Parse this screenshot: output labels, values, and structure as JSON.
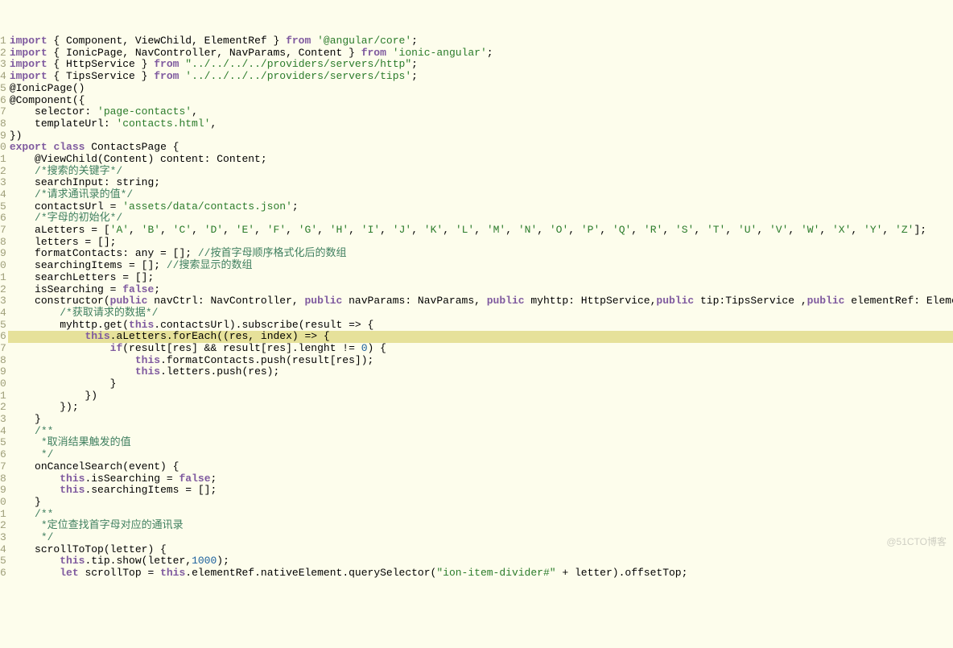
{
  "start_line": 1,
  "highlighted": 16,
  "watermark": "@51CTO博客",
  "lines": [
    {
      "segs": [
        {
          "t": "import",
          "c": "kw"
        },
        {
          "t": " { Component, ViewChild, ElementRef } "
        },
        {
          "t": "from",
          "c": "kw"
        },
        {
          "t": " "
        },
        {
          "t": "'@angular/core'",
          "c": "str"
        },
        {
          "t": ";"
        }
      ]
    },
    {
      "segs": [
        {
          "t": "import",
          "c": "kw"
        },
        {
          "t": " { IonicPage, NavController, NavParams, Content } "
        },
        {
          "t": "from",
          "c": "kw"
        },
        {
          "t": " "
        },
        {
          "t": "'ionic-angular'",
          "c": "str"
        },
        {
          "t": ";"
        }
      ]
    },
    {
      "segs": [
        {
          "t": "import",
          "c": "kw"
        },
        {
          "t": " { HttpService } "
        },
        {
          "t": "from",
          "c": "kw"
        },
        {
          "t": " "
        },
        {
          "t": "\"../../../../providers/servers/http\"",
          "c": "str"
        },
        {
          "t": ";"
        }
      ]
    },
    {
      "segs": [
        {
          "t": "import",
          "c": "kw"
        },
        {
          "t": " { TipsService } "
        },
        {
          "t": "from",
          "c": "kw"
        },
        {
          "t": " "
        },
        {
          "t": "'../../../../providers/servers/tips'",
          "c": "str"
        },
        {
          "t": ";"
        }
      ]
    },
    {
      "segs": [
        {
          "t": "@IonicPage()"
        }
      ],
      "fold": true
    },
    {
      "segs": [
        {
          "t": "@Component({"
        }
      ]
    },
    {
      "segs": [
        {
          "t": "    selector: "
        },
        {
          "t": "'page-contacts'",
          "c": "str"
        },
        {
          "t": ","
        }
      ]
    },
    {
      "segs": [
        {
          "t": "    templateUrl: "
        },
        {
          "t": "'contacts.html'",
          "c": "str"
        },
        {
          "t": ","
        }
      ]
    },
    {
      "segs": [
        {
          "t": "})"
        }
      ]
    },
    {
      "segs": [
        {
          "t": "export",
          "c": "kw"
        },
        {
          "t": " "
        },
        {
          "t": "class",
          "c": "kw"
        },
        {
          "t": " ContactsPage {"
        }
      ]
    },
    {
      "segs": [
        {
          "t": "    @ViewChild(Content) content: Content;"
        }
      ]
    },
    {
      "segs": [
        {
          "t": "    "
        },
        {
          "t": "/*搜索的关键字*/",
          "c": "cm"
        }
      ]
    },
    {
      "segs": [
        {
          "t": "    searchInput: string;"
        }
      ]
    },
    {
      "segs": [
        {
          "t": "    "
        },
        {
          "t": "/*请求通讯录的值*/",
          "c": "cm"
        }
      ]
    },
    {
      "segs": [
        {
          "t": "    contactsUrl = "
        },
        {
          "t": "'assets/data/contacts.json'",
          "c": "str"
        },
        {
          "t": ";"
        }
      ]
    },
    {
      "segs": [
        {
          "t": "    "
        },
        {
          "t": "/*字母的初始化*/",
          "c": "cm"
        }
      ]
    },
    {
      "segs": [
        {
          "t": "    aLetters = ["
        },
        {
          "t": "'A'",
          "c": "str"
        },
        {
          "t": ", "
        },
        {
          "t": "'B'",
          "c": "str"
        },
        {
          "t": ", "
        },
        {
          "t": "'C'",
          "c": "str"
        },
        {
          "t": ", "
        },
        {
          "t": "'D'",
          "c": "str"
        },
        {
          "t": ", "
        },
        {
          "t": "'E'",
          "c": "str"
        },
        {
          "t": ", "
        },
        {
          "t": "'F'",
          "c": "str"
        },
        {
          "t": ", "
        },
        {
          "t": "'G'",
          "c": "str"
        },
        {
          "t": ", "
        },
        {
          "t": "'H'",
          "c": "str"
        },
        {
          "t": ", "
        },
        {
          "t": "'I'",
          "c": "str"
        },
        {
          "t": ", "
        },
        {
          "t": "'J'",
          "c": "str"
        },
        {
          "t": ", "
        },
        {
          "t": "'K'",
          "c": "str"
        },
        {
          "t": ", "
        },
        {
          "t": "'L'",
          "c": "str"
        },
        {
          "t": ", "
        },
        {
          "t": "'M'",
          "c": "str"
        },
        {
          "t": ", "
        },
        {
          "t": "'N'",
          "c": "str"
        },
        {
          "t": ", "
        },
        {
          "t": "'O'",
          "c": "str"
        },
        {
          "t": ", "
        },
        {
          "t": "'P'",
          "c": "str"
        },
        {
          "t": ", "
        },
        {
          "t": "'Q'",
          "c": "str"
        },
        {
          "t": ", "
        },
        {
          "t": "'R'",
          "c": "str"
        },
        {
          "t": ", "
        },
        {
          "t": "'S'",
          "c": "str"
        },
        {
          "t": ", "
        },
        {
          "t": "'T'",
          "c": "str"
        },
        {
          "t": ", "
        },
        {
          "t": "'U'",
          "c": "str"
        },
        {
          "t": ", "
        },
        {
          "t": "'V'",
          "c": "str"
        },
        {
          "t": ", "
        },
        {
          "t": "'W'",
          "c": "str"
        },
        {
          "t": ", "
        },
        {
          "t": "'X'",
          "c": "str"
        },
        {
          "t": ", "
        },
        {
          "t": "'Y'",
          "c": "str"
        },
        {
          "t": ", "
        },
        {
          "t": "'Z'",
          "c": "str"
        },
        {
          "t": "];"
        }
      ]
    },
    {
      "segs": [
        {
          "t": "    letters = [];"
        }
      ]
    },
    {
      "segs": [
        {
          "t": "    formatContacts: any = []; "
        },
        {
          "t": "//按首字母顺序格式化后的数组",
          "c": "cm"
        }
      ]
    },
    {
      "segs": [
        {
          "t": "    searchingItems = []; "
        },
        {
          "t": "//搜索显示的数组",
          "c": "cm"
        }
      ]
    },
    {
      "segs": [
        {
          "t": "    searchLetters = [];"
        }
      ]
    },
    {
      "segs": [
        {
          "t": "    isSearching = "
        },
        {
          "t": "false",
          "c": "val"
        },
        {
          "t": ";"
        }
      ]
    },
    {
      "segs": [
        {
          "t": "    constructor("
        },
        {
          "t": "public",
          "c": "kw"
        },
        {
          "t": " navCtrl: NavController, "
        },
        {
          "t": "public",
          "c": "kw"
        },
        {
          "t": " navParams: NavParams, "
        },
        {
          "t": "public",
          "c": "kw"
        },
        {
          "t": " myhttp: HttpService,"
        },
        {
          "t": "public",
          "c": "kw"
        },
        {
          "t": " tip:TipsService ,"
        },
        {
          "t": "public",
          "c": "kw"
        },
        {
          "t": " elementRef: ElementRef) {"
        }
      ],
      "fold": true
    },
    {
      "segs": [
        {
          "t": "        "
        },
        {
          "t": "/*获取请求的数据*/",
          "c": "cm"
        }
      ]
    },
    {
      "segs": [
        {
          "t": "        myhttp.get("
        },
        {
          "t": "this",
          "c": "kw"
        },
        {
          "t": ".contactsUrl).subscribe(result => {"
        }
      ],
      "fold": true
    },
    {
      "segs": [
        {
          "t": "            "
        },
        {
          "t": "this",
          "c": "kw"
        },
        {
          "t": ".aLetters.forEach((res, index) => {"
        }
      ],
      "fold": true,
      "hl": true
    },
    {
      "segs": [
        {
          "t": "                "
        },
        {
          "t": "if",
          "c": "kw"
        },
        {
          "t": "(result[res] && result[res].lenght != "
        },
        {
          "t": "0",
          "c": "num"
        },
        {
          "t": ") {"
        }
      ],
      "fold": true
    },
    {
      "segs": [
        {
          "t": "                    "
        },
        {
          "t": "this",
          "c": "kw"
        },
        {
          "t": ".formatContacts.push(result[res]);"
        }
      ]
    },
    {
      "segs": [
        {
          "t": "                    "
        },
        {
          "t": "this",
          "c": "kw"
        },
        {
          "t": ".letters.push(res);"
        }
      ]
    },
    {
      "segs": [
        {
          "t": "                }"
        }
      ]
    },
    {
      "segs": [
        {
          "t": "            })"
        }
      ]
    },
    {
      "segs": [
        {
          "t": "        });"
        }
      ]
    },
    {
      "segs": [
        {
          "t": "    }"
        }
      ]
    },
    {
      "segs": [
        {
          "t": "    "
        },
        {
          "t": "/**",
          "c": "cm"
        }
      ]
    },
    {
      "segs": [
        {
          "t": "     *取消结果触发的值",
          "c": "cm"
        }
      ]
    },
    {
      "segs": [
        {
          "t": "     */",
          "c": "cm"
        }
      ]
    },
    {
      "segs": [
        {
          "t": "    onCancelSearch(event) {"
        }
      ],
      "fold": true
    },
    {
      "segs": [
        {
          "t": "        "
        },
        {
          "t": "this",
          "c": "kw"
        },
        {
          "t": ".isSearching = "
        },
        {
          "t": "false",
          "c": "val"
        },
        {
          "t": ";"
        }
      ]
    },
    {
      "segs": [
        {
          "t": "        "
        },
        {
          "t": "this",
          "c": "kw"
        },
        {
          "t": ".searchingItems = [];"
        }
      ]
    },
    {
      "segs": [
        {
          "t": "    }"
        }
      ]
    },
    {
      "segs": [
        {
          "t": "    "
        },
        {
          "t": "/**",
          "c": "cm"
        }
      ]
    },
    {
      "segs": [
        {
          "t": "     *定位查找首字母对应的通讯录",
          "c": "cm"
        }
      ]
    },
    {
      "segs": [
        {
          "t": "     */",
          "c": "cm"
        }
      ]
    },
    {
      "segs": [
        {
          "t": "    scrollToTop(letter) {"
        }
      ],
      "fold": true
    },
    {
      "segs": [
        {
          "t": "        "
        },
        {
          "t": "this",
          "c": "kw"
        },
        {
          "t": ".tip.show(letter,"
        },
        {
          "t": "1000",
          "c": "num"
        },
        {
          "t": ");"
        }
      ]
    },
    {
      "segs": [
        {
          "t": "        "
        },
        {
          "t": "let",
          "c": "kw"
        },
        {
          "t": " scrollTop = "
        },
        {
          "t": "this",
          "c": "kw"
        },
        {
          "t": ".elementRef.nativeElement.querySelector("
        },
        {
          "t": "\"ion-item-divider#\"",
          "c": "str"
        },
        {
          "t": " + letter).offsetTop;"
        }
      ]
    }
  ]
}
